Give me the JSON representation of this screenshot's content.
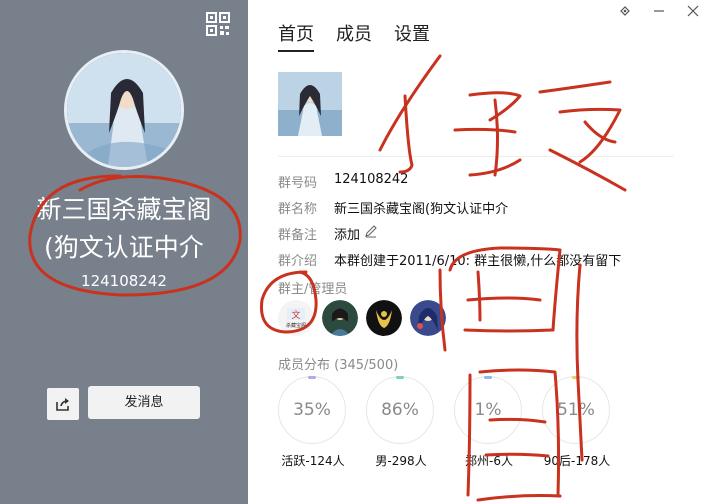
{
  "left": {
    "group_name_line1": "新三国杀藏宝阁",
    "group_name_line2": "(狗文认证中介",
    "group_id": "124108242",
    "send_label": "发消息"
  },
  "tabs": [
    "首页",
    "成员",
    "设置"
  ],
  "info": {
    "id_label": "群号码",
    "id_value": "124108242",
    "name_label": "群名称",
    "name_value": "新三国杀藏宝阁(狗文认证中介",
    "remark_label": "群备注",
    "remark_value": "添加",
    "intro_label": "群介绍",
    "intro_value": "本群创建于2011/6/10:  群主很懒,什么都没有留下"
  },
  "admins_label": "群主/管理员",
  "dist_label": "成员分布 (345/500)",
  "stats": [
    {
      "pct": "35%",
      "caption": "活跃-124人",
      "color": "#b9a6e6"
    },
    {
      "pct": "86%",
      "caption": "男-298人",
      "color": "#7fd3b3"
    },
    {
      "pct": "1%",
      "caption": "郑州-6人",
      "color": "#8cb8ec"
    },
    {
      "pct": "51%",
      "caption": "90后-178人",
      "color": "#f2c66e"
    }
  ],
  "admin_logo_text": "文",
  "admin_logo_subtext": "杀藏宝阁"
}
